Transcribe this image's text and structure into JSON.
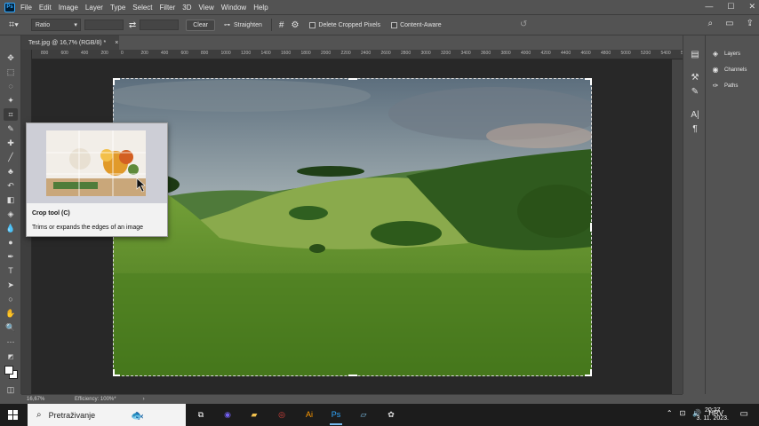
{
  "app": {
    "logo": "Ps"
  },
  "menu": [
    "File",
    "Edit",
    "Image",
    "Layer",
    "Type",
    "Select",
    "Filter",
    "3D",
    "View",
    "Window",
    "Help"
  ],
  "window_controls": [
    "—",
    "☐",
    "✕"
  ],
  "options": {
    "ratio_value": "Ratio",
    "clear_label": "Clear",
    "straighten_label": "Straighten",
    "delete_cropped_label": "Delete Cropped Pixels",
    "content_aware_label": "Content-Aware"
  },
  "document": {
    "tab_title": "Test.jpg @ 16,7% (RGB/8) *",
    "close": "×"
  },
  "ruler_ticks": [
    "800",
    "600",
    "400",
    "200",
    "0",
    "200",
    "400",
    "600",
    "800",
    "1000",
    "1200",
    "1400",
    "1600",
    "1800",
    "2000",
    "2200",
    "2400",
    "2600",
    "2800",
    "3000",
    "3200",
    "3400",
    "3600",
    "3800",
    "4000",
    "4200",
    "4400",
    "4600",
    "4800",
    "5000",
    "5200",
    "5400",
    "5600"
  ],
  "tooltip": {
    "title": "Crop tool (C)",
    "description": "Trims or expands the edges of an image"
  },
  "panels": [
    {
      "label": "Layers",
      "icon": "layers-icon"
    },
    {
      "label": "Channels",
      "icon": "channels-icon"
    },
    {
      "label": "Paths",
      "icon": "paths-icon"
    }
  ],
  "status": {
    "zoom": "16,67%",
    "efficiency": "Efficiency: 100%*",
    "arrow": "›"
  },
  "taskbar": {
    "search_placeholder": "Pretraživanje",
    "language": "HRV",
    "time": "20:27",
    "date": "3. 11. 2023."
  },
  "colors": {
    "accent": "#31a8ff",
    "panel_bg": "#535353",
    "canvas_bg": "#282828",
    "taskbar_bg": "#1c1c1c"
  }
}
